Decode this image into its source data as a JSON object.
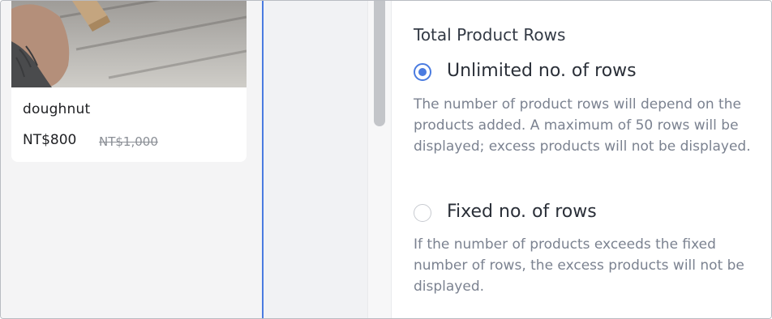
{
  "product_card": {
    "name": "doughnut",
    "price": "NT$800",
    "original_price": "NT$1,000"
  },
  "settings": {
    "section_title": "Total Product Rows",
    "options": [
      {
        "label": "Unlimited no. of rows",
        "selected": true,
        "description": "The number of product rows will depend on the products added. A maximum of 50 rows will be displayed; excess products will not be displayed."
      },
      {
        "label": "Fixed no. of rows",
        "selected": false,
        "description": "If the number of products exceeds the fixed number of rows, the excess products will not be displayed."
      }
    ]
  },
  "colors": {
    "accent": "#4a7be0",
    "description_text": "#7b8290",
    "preview_background": "#f4f4f5"
  }
}
